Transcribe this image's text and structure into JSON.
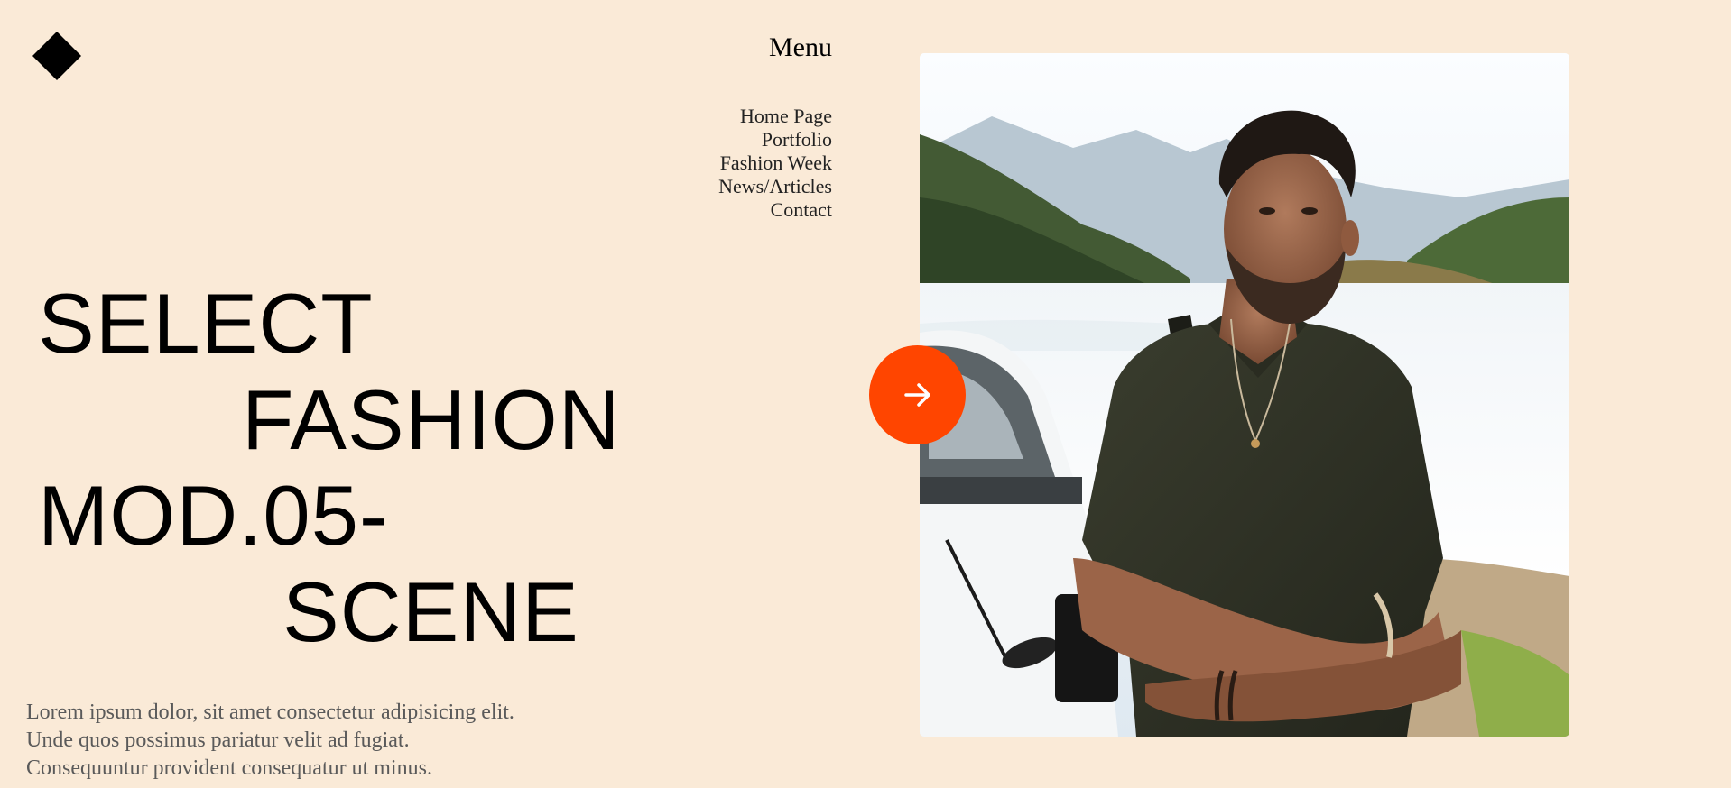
{
  "logo": {
    "icon": "diamond-logo-icon",
    "color": "#000000"
  },
  "menu": {
    "title": "Menu",
    "items": [
      {
        "label": "Home Page"
      },
      {
        "label": "Portfolio"
      },
      {
        "label": "Fashion Week"
      },
      {
        "label": "News/Articles"
      },
      {
        "label": "Contact"
      }
    ]
  },
  "hero": {
    "headline_lines": [
      "SELECT",
      "FASHION",
      "MOD.05-",
      "SCENE"
    ],
    "description_lines": [
      "Lorem ipsum dolor, sit amet consectetur adipisicing elit.",
      "Unde quos possimus pariatur velit ad fugiat.",
      "Consequuntur provident consequatur ut minus."
    ]
  },
  "next_button": {
    "icon": "arrow-right-icon",
    "color": "#FF4500"
  },
  "photo": {
    "subject": "model-photo"
  },
  "colors": {
    "background": "#FAEAD7",
    "accent": "#FF4500",
    "text": "#000000",
    "muted_text": "#5A5A5A"
  }
}
